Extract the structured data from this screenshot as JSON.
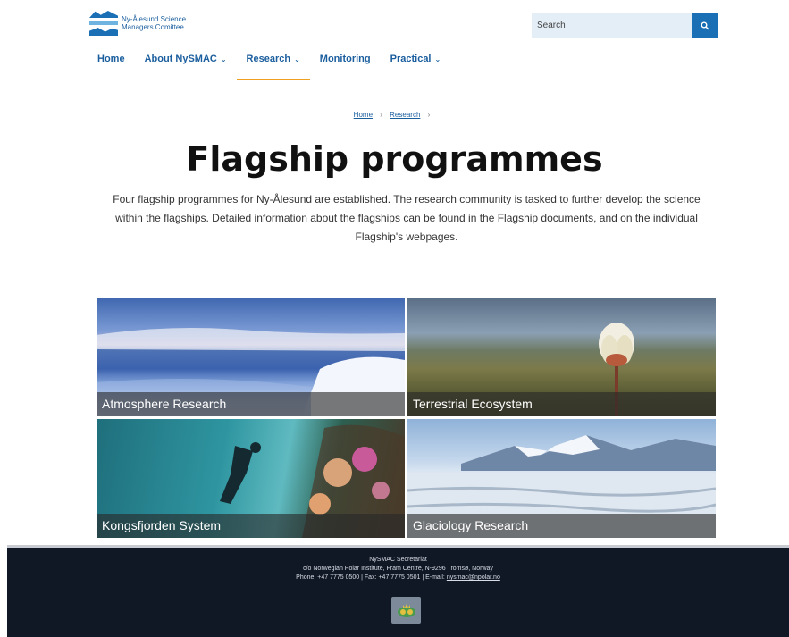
{
  "header": {
    "logo_line1": "Ny-Ålesund Science",
    "logo_line2": "Managers Comittee",
    "search_placeholder": "Search"
  },
  "nav": {
    "items": [
      {
        "label": "Home",
        "has_dropdown": false
      },
      {
        "label": "About NySMAC",
        "has_dropdown": true
      },
      {
        "label": "Research",
        "has_dropdown": true,
        "active": true
      },
      {
        "label": "Monitoring",
        "has_dropdown": false
      },
      {
        "label": "Practical",
        "has_dropdown": true
      }
    ]
  },
  "breadcrumb": {
    "home": "Home",
    "research": "Research",
    "separator": "›"
  },
  "page": {
    "title": "Flagship programmes",
    "intro": "Four flagship programmes for Ny-Ålesund are established. The research community is tasked to further develop the science within the flagships. Detailed information about the flagships can be found in the Flagship documents, and on the individual Flagship's webpages."
  },
  "flagships": [
    {
      "label": "Atmosphere Research",
      "image": "snowy-landscape-photo"
    },
    {
      "label": "Terrestrial Ecosystem",
      "image": "arctic-flower-photo"
    },
    {
      "label": "Kongsfjorden System",
      "image": "diver-underwater-photo"
    },
    {
      "label": "Glaciology Research",
      "image": "glacier-mountains-photo"
    }
  ],
  "footer": {
    "line1": "NySMAC Secretariat",
    "line2": "c/o Norwegian Polar Institute, Fram Centre, N-9296 Tromsø, Norway",
    "phone_fax": "Phone: +47 7775 0500 | Fax: +47 7775 0501 | E-mail: ",
    "email": "nysmac@npolar.no"
  },
  "colors": {
    "brand_blue": "#1b6fb5",
    "nav_text": "#1b5e9e",
    "active_underline": "#f0a020",
    "footer_bg": "#101826"
  }
}
